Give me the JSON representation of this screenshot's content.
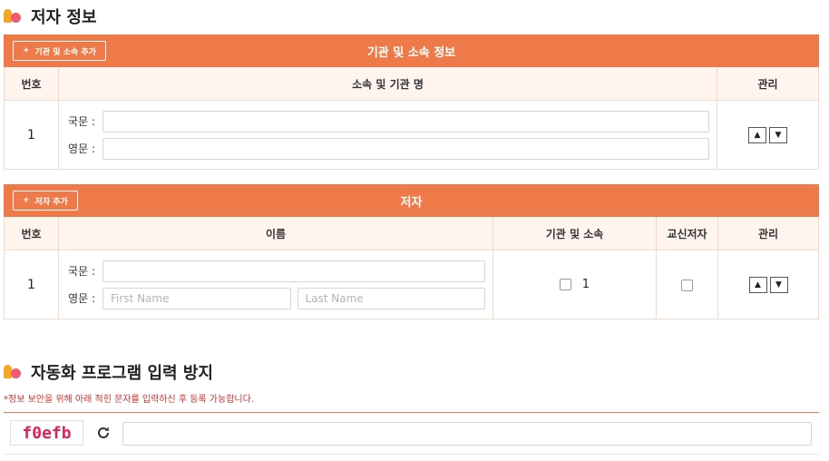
{
  "section1": {
    "title": "저자 정보"
  },
  "affiliation": {
    "bar_title": "기관 및 소속 정보",
    "add_button": "기관 및 소속 추가",
    "plus": "+",
    "headers": [
      "번호",
      "소속 및 기관 명",
      "관리"
    ],
    "row": {
      "number": "1",
      "korean_label": "국문 :",
      "english_label": "영문 :",
      "korean_value": "",
      "english_value": ""
    }
  },
  "author": {
    "bar_title": "저자",
    "add_button": "저자 추가",
    "plus": "+",
    "headers": [
      "번호",
      "이름",
      "기관 및 소속",
      "교신저자",
      "관리"
    ],
    "row": {
      "number": "1",
      "korean_label": "국문 :",
      "english_label": "영문 :",
      "first_name_placeholder": "First Name",
      "last_name_placeholder": "Last Name",
      "affiliation_option": "1"
    }
  },
  "section2": {
    "title": "자동화 프로그램 입력 방지"
  },
  "captcha": {
    "notice": "*정보 보안을 위해 아래 적힌 문자를 입력하신 후 등록 가능합니다.",
    "code": "f0efb",
    "input_value": ""
  },
  "arrows": {
    "up": "▲",
    "down": "▼"
  },
  "colors": {
    "accent": "#ee7a4a",
    "captcha_text": "#e0205a",
    "notice": "#d03030"
  }
}
